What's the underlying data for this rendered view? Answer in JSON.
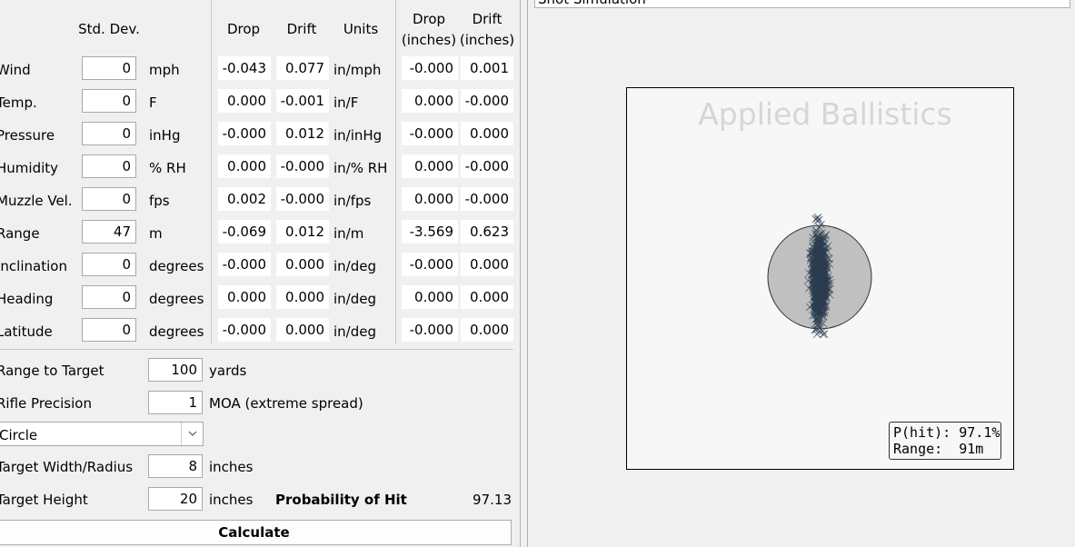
{
  "header": {
    "std_dev": "Std. Dev.",
    "drop": "Drop",
    "drift": "Drift",
    "units": "Units",
    "drop_in": "Drop",
    "drop_in_sub": "(inches)",
    "drift_in": "Drift",
    "drift_in_sub": "(inches)"
  },
  "rows": [
    {
      "label": "Wind",
      "std": "0",
      "unit": "mph",
      "drop": "-0.043",
      "drift": "0.077",
      "units": "in/mph",
      "drop_in": "-0.000",
      "drift_in": "0.001"
    },
    {
      "label": "Temp.",
      "std": "0",
      "unit": "F",
      "drop": "0.000",
      "drift": "-0.001",
      "units": "in/F",
      "drop_in": "0.000",
      "drift_in": "-0.000"
    },
    {
      "label": "Pressure",
      "std": "0",
      "unit": "inHg",
      "drop": "-0.000",
      "drift": "0.012",
      "units": "in/inHg",
      "drop_in": "-0.000",
      "drift_in": "0.000"
    },
    {
      "label": "Humidity",
      "std": "0",
      "unit": "% RH",
      "drop": "0.000",
      "drift": "-0.000",
      "units": "in/% RH",
      "drop_in": "0.000",
      "drift_in": "-0.000"
    },
    {
      "label": "Muzzle Vel.",
      "std": "0",
      "unit": "fps",
      "drop": "0.002",
      "drift": "-0.000",
      "units": "in/fps",
      "drop_in": "0.000",
      "drift_in": "-0.000"
    },
    {
      "label": "Range",
      "std": "47",
      "unit": "m",
      "drop": "-0.069",
      "drift": "0.012",
      "units": "in/m",
      "drop_in": "-3.569",
      "drift_in": "0.623"
    },
    {
      "label": "Inclination",
      "std": "0",
      "unit": "degrees",
      "drop": "-0.000",
      "drift": "0.000",
      "units": "in/deg",
      "drop_in": "-0.000",
      "drift_in": "0.000"
    },
    {
      "label": "Heading",
      "std": "0",
      "unit": "degrees",
      "drop": "0.000",
      "drift": "0.000",
      "units": "in/deg",
      "drop_in": "0.000",
      "drift_in": "0.000"
    },
    {
      "label": "Latitude",
      "std": "0",
      "unit": "degrees",
      "drop": "-0.000",
      "drift": "0.000",
      "units": "in/deg",
      "drop_in": "-0.000",
      "drift_in": "0.000"
    }
  ],
  "settings": {
    "range_label": "Range to Target",
    "range_value": "100",
    "range_unit": "yards",
    "precision_label": "Rifle Precision",
    "precision_value": "1",
    "precision_unit": "MOA (extreme spread)",
    "shape_value": "Circle",
    "width_label": "Target Width/Radius",
    "width_value": "8",
    "width_unit": "inches",
    "height_label": "Target Height",
    "height_value": "20",
    "height_unit": "inches",
    "prob_label": "Probability of Hit",
    "prob_value": "97.13",
    "calculate_label": "Calculate"
  },
  "simulation": {
    "title": "Shot Simulation",
    "watermark": "Applied Ballistics",
    "p_hit": "P(hit): 97.1%",
    "range": "Range:  91m",
    "shot_color": "#2c3e50",
    "target_color": "#c0c0c0"
  }
}
